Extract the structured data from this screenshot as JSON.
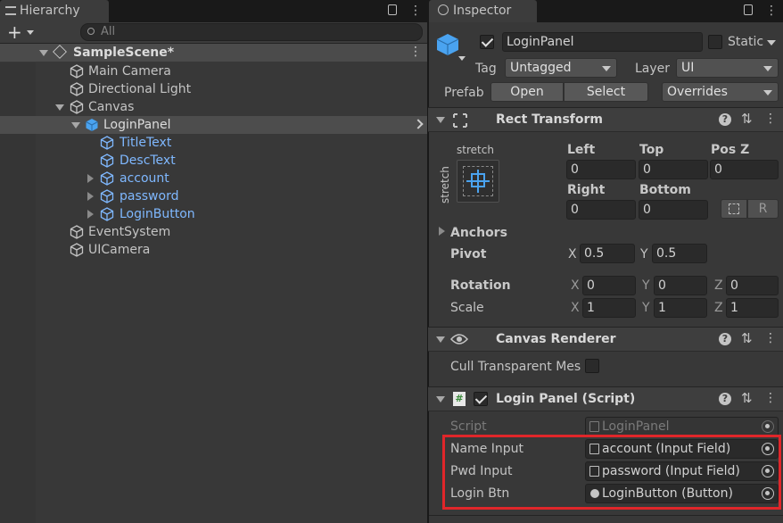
{
  "hierarchy": {
    "tab_title": "Hierarchy",
    "search_placeholder": "All",
    "scene": "SampleScene*",
    "items": [
      {
        "label": "Main Camera"
      },
      {
        "label": "Directional Light"
      },
      {
        "label": "Canvas"
      },
      {
        "label": "LoginPanel"
      },
      {
        "label": "TitleText"
      },
      {
        "label": "DescText"
      },
      {
        "label": "account"
      },
      {
        "label": "password"
      },
      {
        "label": "LoginButton"
      },
      {
        "label": "EventSystem"
      },
      {
        "label": "UICamera"
      }
    ]
  },
  "inspector": {
    "tab_title": "Inspector",
    "object_name": "LoginPanel",
    "static_label": "Static",
    "tag_label": "Tag",
    "tag_value": "Untagged",
    "layer_label": "Layer",
    "layer_value": "UI",
    "prefab_label": "Prefab",
    "open_label": "Open",
    "select_label": "Select",
    "overrides_label": "Overrides",
    "rect_transform": {
      "title": "Rect Transform",
      "anchor_h": "stretch",
      "anchor_v": "stretch",
      "left_label": "Left",
      "left": "0",
      "top_label": "Top",
      "top": "0",
      "posz_label": "Pos Z",
      "posz": "0",
      "right_label": "Right",
      "right": "0",
      "bottom_label": "Bottom",
      "bottom": "0",
      "r_label": "R",
      "anchors_label": "Anchors",
      "pivot_label": "Pivot",
      "pivot_x": "0.5",
      "pivot_y": "0.5",
      "rotation_label": "Rotation",
      "rot_x": "0",
      "rot_y": "0",
      "rot_z": "0",
      "scale_label": "Scale",
      "scale_x": "1",
      "scale_y": "1",
      "scale_z": "1",
      "x": "X",
      "y": "Y",
      "z": "Z"
    },
    "canvas_renderer": {
      "title": "Canvas Renderer",
      "cull_label": "Cull Transparent Mes"
    },
    "login_panel": {
      "title": "Login Panel (Script)",
      "script_label": "Script",
      "script_value": "LoginPanel",
      "name_input_label": "Name Input",
      "name_input_value": "account (Input Field)",
      "pwd_input_label": "Pwd Input",
      "pwd_input_value": "password (Input Field)",
      "login_btn_label": "Login Btn",
      "login_btn_value": "LoginButton (Button)"
    }
  },
  "colors": {
    "highlight_box": "#e0262a",
    "link_blue": "#7fb8ff",
    "cube_selected": "#4aa3f0"
  }
}
